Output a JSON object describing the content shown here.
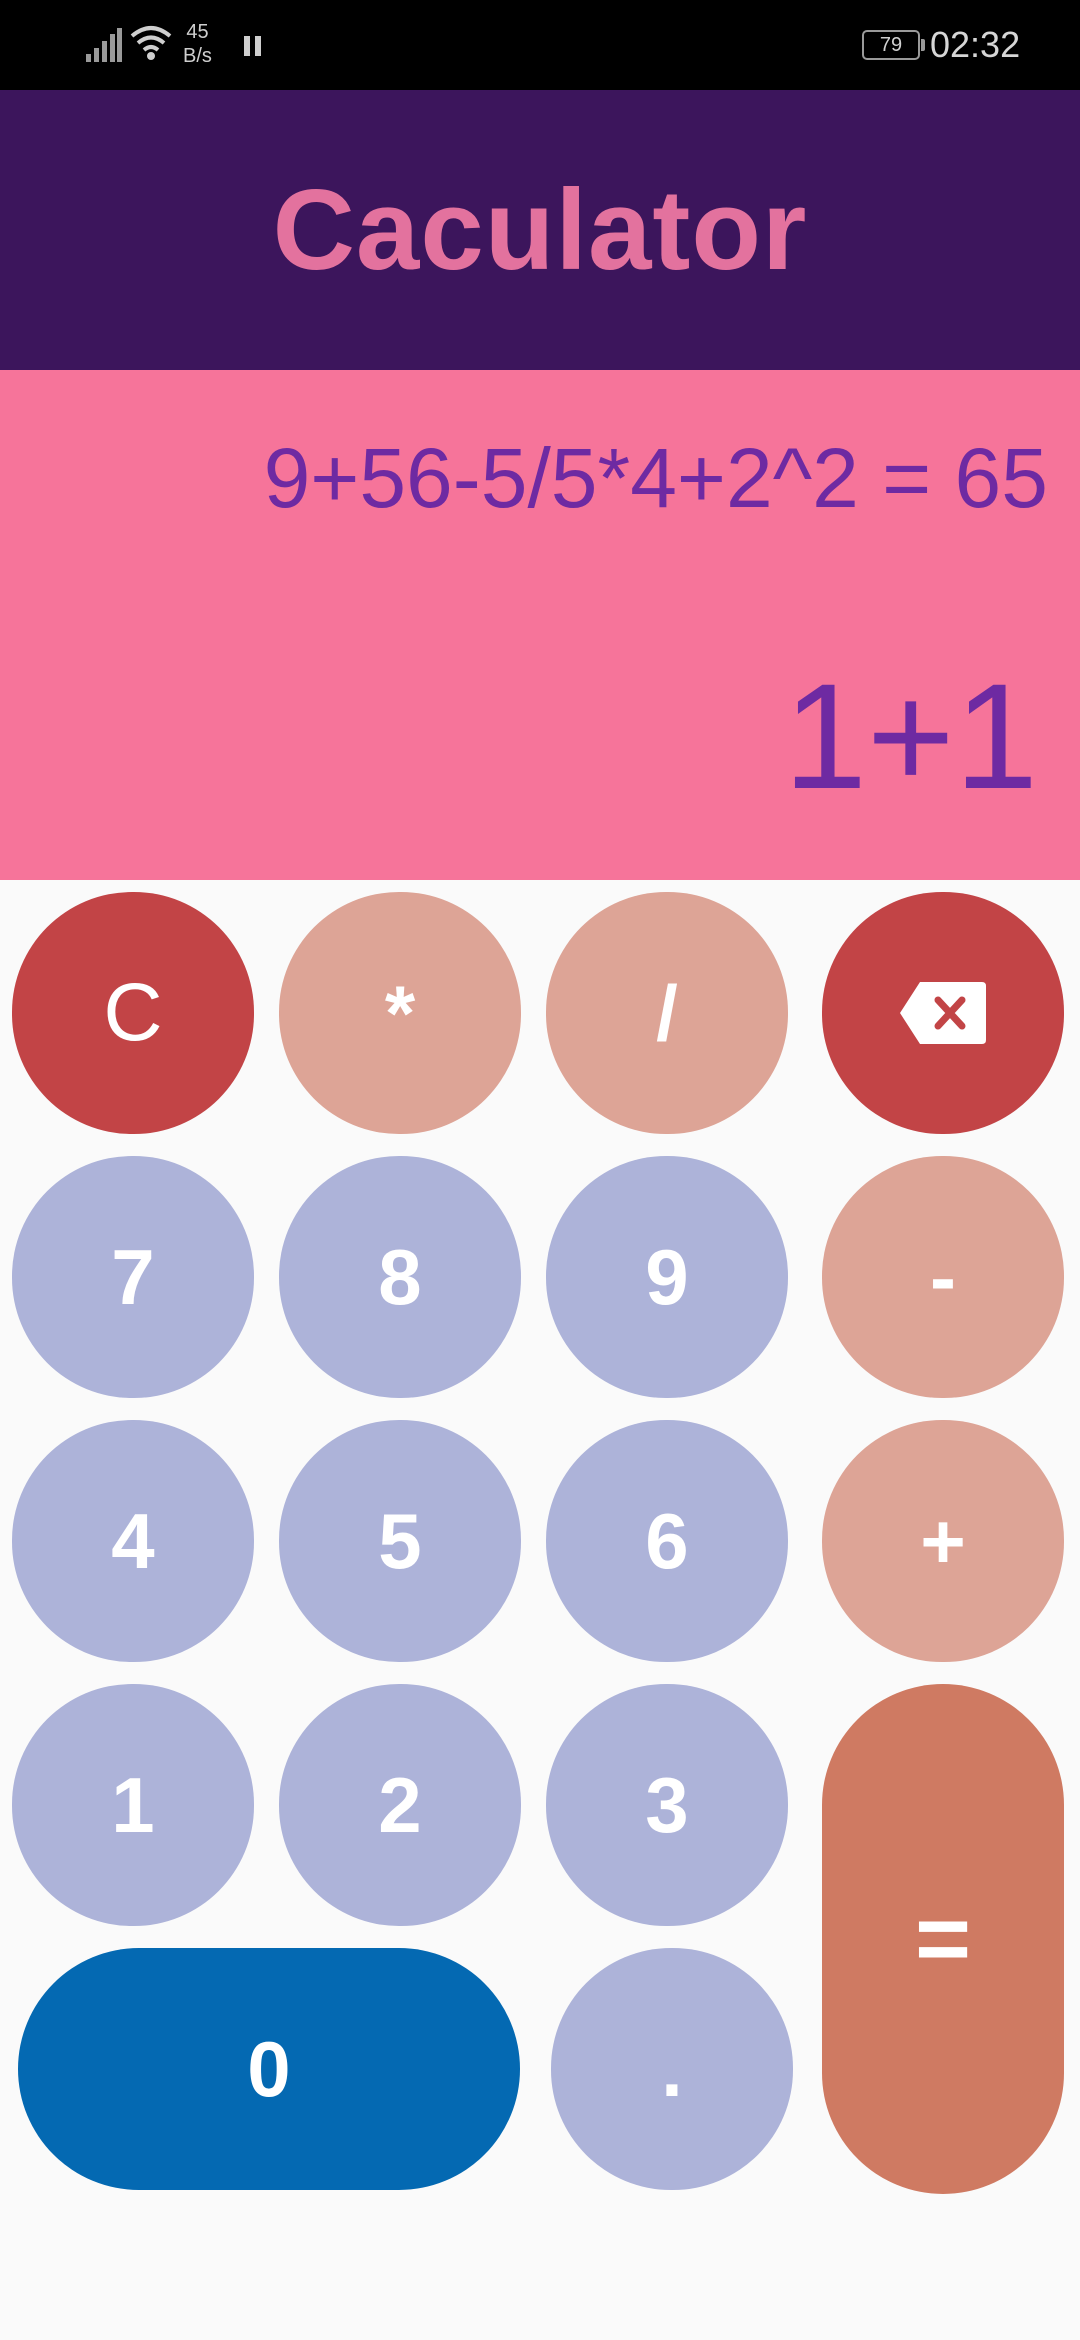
{
  "status_bar": {
    "network_speed_value": "45",
    "network_speed_unit": "B/s",
    "battery": "79",
    "time": "02:32"
  },
  "header": {
    "title": "Caculator"
  },
  "display": {
    "history": "9+56-5/5*4+2^2 = 65",
    "input": "1+1"
  },
  "keys": {
    "clear": "C",
    "multiply": "*",
    "divide": "/",
    "backspace_icon": "backspace-icon",
    "seven": "7",
    "eight": "8",
    "nine": "9",
    "minus": "-",
    "four": "4",
    "five": "5",
    "six": "6",
    "plus": "+",
    "one": "1",
    "two": "2",
    "three": "3",
    "equals": "=",
    "zero": "0",
    "decimal": "."
  },
  "colors": {
    "header_bg": "#3c155c",
    "title": "#e3729e",
    "display_bg": "#f6749a",
    "display_text": "#6e2aa2",
    "number_key": "#adb3d9",
    "operator_key": "#dda496",
    "clear_key": "#c24446",
    "zero_key": "#0469b2",
    "equals_key": "#cf7a62"
  }
}
